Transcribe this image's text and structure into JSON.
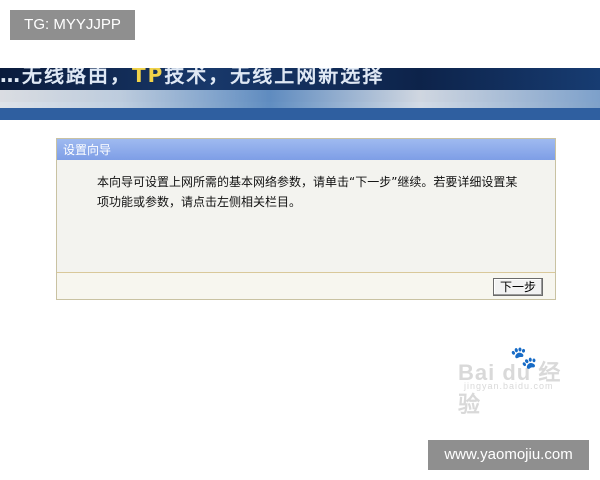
{
  "overlay": {
    "top_left_tag": "TG: MYYJJPP",
    "bottom_right_tag": "www.yaomojiu.com"
  },
  "banner": {
    "title_left": "…无线路由，",
    "title_highlight": "TP",
    "title_right": "技术，无线上网新选择"
  },
  "wizard": {
    "title": "设置向导",
    "description": "本向导可设置上网所需的基本网络参数，请单击“下一步”继续。若要详细设置某项功能或参数，请点击左侧相关栏目。",
    "next_label": "下一步"
  },
  "watermark": {
    "brand": "Bai du 经验",
    "url": "jingyan.baidu.com"
  }
}
